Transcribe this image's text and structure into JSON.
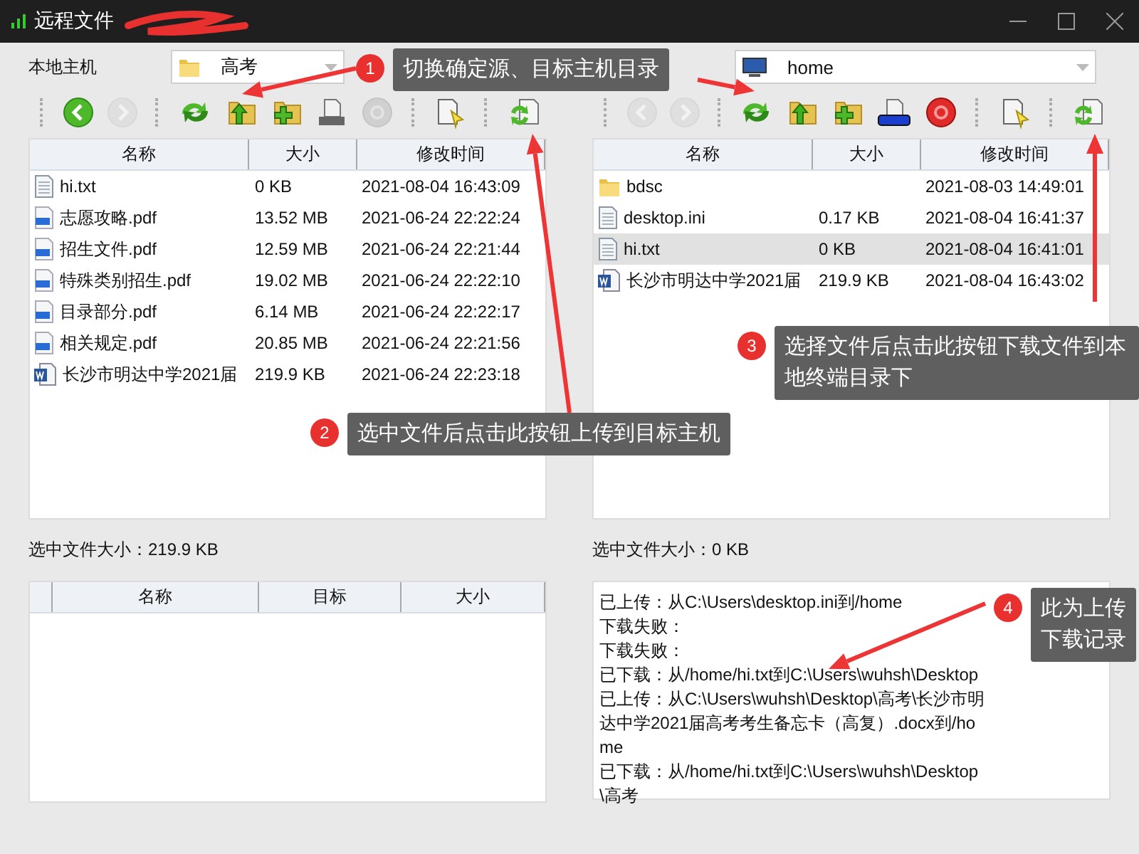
{
  "window": {
    "title": "远程文件"
  },
  "panes": [
    {
      "label": "本地主机",
      "location": {
        "value": "高考"
      },
      "toolbar": [
        [
          {
            "kind": "back",
            "disabled": false
          },
          {
            "kind": "forward",
            "disabled": true
          }
        ],
        [
          {
            "kind": "refresh",
            "disabled": false
          },
          {
            "kind": "folder-up",
            "disabled": false
          },
          {
            "kind": "new-folder",
            "disabled": false
          },
          {
            "kind": "drive",
            "disabled": false
          },
          {
            "kind": "stop",
            "disabled": true
          }
        ],
        [
          {
            "kind": "select-file",
            "disabled": false
          }
        ],
        [
          {
            "kind": "transfer",
            "disabled": false
          }
        ]
      ],
      "columns": [
        "名称",
        "大小",
        "修改时间"
      ],
      "rows": [
        {
          "kind": "text",
          "name": "hi.txt",
          "size": "0 KB",
          "time": "2021-08-04 16:43:09",
          "selected": false
        },
        {
          "kind": "pdf",
          "name": "志愿攻略.pdf",
          "size": "13.52 MB",
          "time": "2021-06-24 22:22:24",
          "selected": false
        },
        {
          "kind": "pdf",
          "name": "招生文件.pdf",
          "size": "12.59 MB",
          "time": "2021-06-24 22:21:44",
          "selected": false
        },
        {
          "kind": "pdf",
          "name": "特殊类别招生.pdf",
          "size": "19.02 MB",
          "time": "2021-06-24 22:22:10",
          "selected": false
        },
        {
          "kind": "pdf",
          "name": "目录部分.pdf",
          "size": "6.14 MB",
          "time": "2021-06-24 22:22:17",
          "selected": false
        },
        {
          "kind": "pdf",
          "name": "相关规定.pdf",
          "size": "20.85 MB",
          "time": "2021-06-24 22:21:56",
          "selected": false
        },
        {
          "kind": "word",
          "name": "长沙市明达中学2021届",
          "size": "219.9 KB",
          "time": "2021-06-24 22:23:18",
          "selected": false
        }
      ],
      "selected_size": "选中文件大小：219.9 KB",
      "bottom": {
        "kind": "queue",
        "columns": [
          "名称",
          "目标",
          "大小"
        ]
      }
    },
    {
      "location": {
        "value": "home"
      },
      "toolbar": [
        [
          {
            "kind": "back",
            "disabled": true
          },
          {
            "kind": "forward",
            "disabled": true
          }
        ],
        [
          {
            "kind": "refresh",
            "disabled": false
          },
          {
            "kind": "folder-up",
            "disabled": false
          },
          {
            "kind": "new-folder",
            "disabled": false
          },
          {
            "kind": "html-drive",
            "disabled": false
          },
          {
            "kind": "stop",
            "disabled": false
          }
        ],
        [
          {
            "kind": "select-file",
            "disabled": false
          }
        ],
        [
          {
            "kind": "transfer",
            "disabled": false
          }
        ]
      ],
      "columns": [
        "名称",
        "大小",
        "修改时间"
      ],
      "rows": [
        {
          "kind": "folder",
          "name": "bdsc",
          "size": "",
          "time": "2021-08-03 14:49:01",
          "selected": false
        },
        {
          "kind": "text",
          "name": "desktop.ini",
          "size": "0.17 KB",
          "time": "2021-08-04 16:41:37",
          "selected": false
        },
        {
          "kind": "text",
          "name": "hi.txt",
          "size": "0 KB",
          "time": "2021-08-04 16:41:01",
          "selected": true
        },
        {
          "kind": "word",
          "name": "长沙市明达中学2021届",
          "size": "219.9 KB",
          "time": "2021-08-04 16:43:02",
          "selected": false
        }
      ],
      "selected_size": "选中文件大小：0 KB",
      "bottom": {
        "kind": "log",
        "lines": [
          "已上传：从C:\\Users\\desktop.ini到/home",
          "下载失败：",
          "下载失败：",
          "已下载：从/home/hi.txt到C:\\Users\\wuhsh\\Desktop",
          "已上传：从C:\\Users\\wuhsh\\Desktop\\高考\\长沙市明达中学2021届高考考生备忘卡（高复）.docx到/home",
          "已下载：从/home/hi.txt到C:\\Users\\wuhsh\\Desktop\\高考"
        ]
      }
    }
  ],
  "callouts": [
    {
      "number": "1",
      "text": "切换确定源、目标主机目录"
    },
    {
      "number": "2",
      "text": "选中文件后点击此按钮上传到目标主机"
    },
    {
      "number": "3",
      "text": "选择文件后点击此按钮下载文件到本地终端目录下"
    },
    {
      "number": "4",
      "text": "此为上传下载记录"
    }
  ]
}
